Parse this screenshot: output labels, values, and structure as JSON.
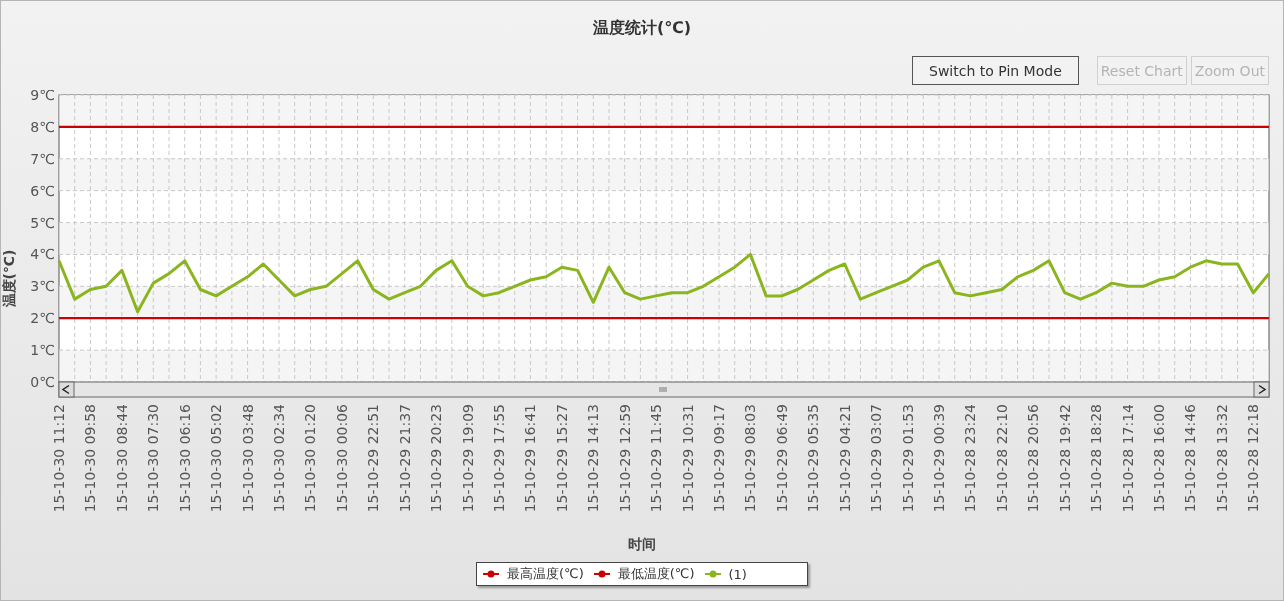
{
  "title": "温度统计(℃)",
  "buttons": [
    {
      "label": "Switch to Pin Mode",
      "disabled": false
    },
    {
      "label": "Reset Chart",
      "disabled": true
    },
    {
      "label": "Zoom Out",
      "disabled": true
    }
  ],
  "chart": {
    "chart_data": {
      "type": "line",
      "ylabel": "温度(℃)",
      "xlabel": "时间",
      "categories": [
        "15-10-30 11:12",
        null,
        "15-10-30 09:58",
        null,
        "15-10-30 08:44",
        null,
        "15-10-30 07:30",
        null,
        "15-10-30 06:16",
        null,
        "15-10-30 05:02",
        null,
        "15-10-30 03:48",
        null,
        "15-10-30 02:34",
        null,
        "15-10-30 01:20",
        null,
        "15-10-30 00:06",
        null,
        "15-10-29 22:51",
        null,
        "15-10-29 21:37",
        null,
        "15-10-29 20:23",
        null,
        "15-10-29 19:09",
        null,
        "15-10-29 17:55",
        null,
        "15-10-29 16:41",
        null,
        "15-10-29 15:27",
        null,
        "15-10-29 14:13",
        null,
        "15-10-29 12:59",
        null,
        "15-10-29 11:45",
        null,
        "15-10-29 10:31",
        null,
        "15-10-29 09:17",
        null,
        "15-10-29 08:03",
        null,
        "15-10-29 06:49",
        null,
        "15-10-29 05:35",
        null,
        "15-10-29 04:21",
        null,
        "15-10-29 03:07",
        null,
        "15-10-29 01:53",
        null,
        "15-10-29 00:39",
        null,
        "15-10-28 23:24",
        null,
        "15-10-28 22:10",
        null,
        "15-10-28 20:56",
        null,
        "15-10-28 19:42",
        null,
        "15-10-28 18:28",
        null,
        "15-10-28 17:14",
        null,
        "15-10-28 16:00",
        null,
        "15-10-28 14:46",
        null,
        "15-10-28 13:32",
        null,
        "15-10-28 12:18",
        null
      ],
      "series": [
        {
          "name": "最高温度(℃)",
          "color": "#cc0000",
          "values": [
            8,
            8,
            8,
            8,
            8,
            8,
            8,
            8,
            8,
            8,
            8,
            8,
            8,
            8,
            8,
            8,
            8,
            8,
            8,
            8,
            8,
            8,
            8,
            8,
            8,
            8,
            8,
            8,
            8,
            8,
            8,
            8,
            8,
            8,
            8,
            8,
            8,
            8,
            8,
            8,
            8,
            8,
            8,
            8,
            8,
            8,
            8,
            8,
            8,
            8,
            8,
            8,
            8,
            8,
            8,
            8,
            8,
            8,
            8,
            8,
            8,
            8,
            8,
            8,
            8,
            8,
            8,
            8,
            8,
            8,
            8,
            8,
            8,
            8,
            8,
            8,
            8,
            8
          ]
        },
        {
          "name": "最低温度(℃)",
          "color": "#cc0000",
          "values": [
            2,
            2,
            2,
            2,
            2,
            2,
            2,
            2,
            2,
            2,
            2,
            2,
            2,
            2,
            2,
            2,
            2,
            2,
            2,
            2,
            2,
            2,
            2,
            2,
            2,
            2,
            2,
            2,
            2,
            2,
            2,
            2,
            2,
            2,
            2,
            2,
            2,
            2,
            2,
            2,
            2,
            2,
            2,
            2,
            2,
            2,
            2,
            2,
            2,
            2,
            2,
            2,
            2,
            2,
            2,
            2,
            2,
            2,
            2,
            2,
            2,
            2,
            2,
            2,
            2,
            2,
            2,
            2,
            2,
            2,
            2,
            2,
            2,
            2,
            2,
            2,
            2,
            2
          ]
        },
        {
          "name": "(1)",
          "color": "#8ab51f",
          "values": [
            3.8,
            2.6,
            2.9,
            3.0,
            3.5,
            2.2,
            3.1,
            3.4,
            3.8,
            2.9,
            2.7,
            3.0,
            3.3,
            3.7,
            3.2,
            2.7,
            2.9,
            3.0,
            3.4,
            3.8,
            2.9,
            2.6,
            2.8,
            3.0,
            3.5,
            3.8,
            3.0,
            2.7,
            2.8,
            3.0,
            3.2,
            3.3,
            3.6,
            3.5,
            2.5,
            3.6,
            2.8,
            2.6,
            2.7,
            2.8,
            2.8,
            3.0,
            3.3,
            3.6,
            4.0,
            2.7,
            2.7,
            2.9,
            3.2,
            3.5,
            3.7,
            2.6,
            2.8,
            3.0,
            3.2,
            3.6,
            3.8,
            2.8,
            2.7,
            2.8,
            2.9,
            3.3,
            3.5,
            3.8,
            2.8,
            2.6,
            2.8,
            3.1,
            3.0,
            3.0,
            3.2,
            3.3,
            3.6,
            3.8,
            3.7,
            3.7,
            2.8,
            3.4
          ]
        }
      ],
      "ylim": [
        0,
        9
      ],
      "grid": true,
      "yticks": [
        {
          "value": 0,
          "label": "0℃"
        },
        {
          "value": 1,
          "label": "1℃"
        },
        {
          "value": 2,
          "label": "2℃"
        },
        {
          "value": 3,
          "label": "3℃"
        },
        {
          "value": 4,
          "label": "4℃"
        },
        {
          "value": 5,
          "label": "5℃"
        },
        {
          "value": 6,
          "label": "6℃"
        },
        {
          "value": 7,
          "label": "7℃"
        },
        {
          "value": 8,
          "label": "8℃"
        },
        {
          "value": 9,
          "label": "9℃"
        }
      ]
    }
  }
}
